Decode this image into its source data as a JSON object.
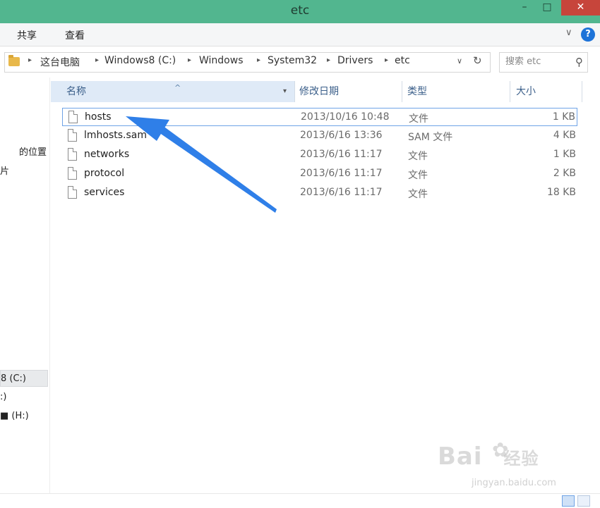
{
  "window": {
    "title": "etc"
  },
  "window_controls": {
    "minimize": "–",
    "maximize": "□",
    "close": "✕"
  },
  "ribbon": {
    "tabs": [
      "共享",
      "查看"
    ],
    "expand_glyph": "∨",
    "help_glyph": "?"
  },
  "address": {
    "crumbs": [
      "这台电脑",
      "Windows8 (C:)",
      "Windows",
      "System32",
      "Drivers",
      "etc"
    ],
    "separator": "▸",
    "dropdown_glyph": "∨",
    "refresh_glyph": "↻"
  },
  "search": {
    "placeholder": "搜索 etc",
    "icon_glyph": "⚲"
  },
  "nav_pane": {
    "items": [
      {
        "label": "的位置",
        "selected": false
      },
      {
        "label": "片",
        "selected": false
      },
      {
        "label": "8 (C:)",
        "selected": true
      },
      {
        "label": ":)",
        "selected": false
      },
      {
        "label": "■ (H:)",
        "selected": false
      }
    ]
  },
  "columns": {
    "name": "名称",
    "date": "修改日期",
    "type": "类型",
    "size": "大小",
    "sort_glyph": "^",
    "filter_glyph": "▾"
  },
  "files": [
    {
      "name": "hosts",
      "date": "2013/10/16 10:48",
      "type": "文件",
      "size": "1 KB",
      "selected": true
    },
    {
      "name": "lmhosts.sam",
      "date": "2013/6/16 13:36",
      "type": "SAM 文件",
      "size": "4 KB",
      "selected": false
    },
    {
      "name": "networks",
      "date": "2013/6/16 11:17",
      "type": "文件",
      "size": "1 KB",
      "selected": false
    },
    {
      "name": "protocol",
      "date": "2013/6/16 11:17",
      "type": "文件",
      "size": "2 KB",
      "selected": false
    },
    {
      "name": "services",
      "date": "2013/6/16 11:17",
      "type": "文件",
      "size": "18 KB",
      "selected": false
    }
  ],
  "annotation": {
    "arrow_color": "#2f7fe8"
  },
  "watermark": {
    "brand": "Bai",
    "brand_suffix": "经验",
    "url": "jingyan.baidu.com",
    "paw_glyph": "✿"
  },
  "colors": {
    "titlebar": "#52b68f",
    "close_button": "#c7453b",
    "selection_border": "#6fa3e6",
    "header_highlight": "#dfeaf7"
  }
}
